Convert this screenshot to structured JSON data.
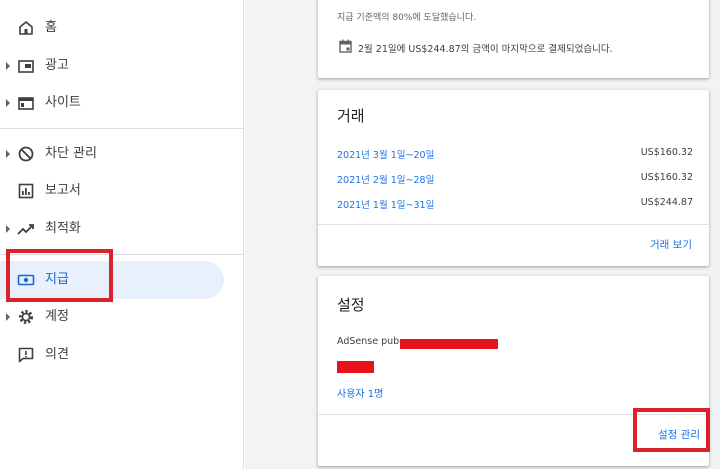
{
  "sidebar": {
    "items": [
      {
        "label": "홈",
        "icon": "home-icon"
      },
      {
        "label": "광고",
        "icon": "ads-icon"
      },
      {
        "label": "사이트",
        "icon": "sites-icon"
      },
      {
        "label": "차단 관리",
        "icon": "block-icon"
      },
      {
        "label": "보고서",
        "icon": "reports-icon"
      },
      {
        "label": "최적화",
        "icon": "trending-up-icon"
      },
      {
        "label": "지급",
        "icon": "payments-icon"
      },
      {
        "label": "계정",
        "icon": "gear-icon"
      },
      {
        "label": "의견",
        "icon": "feedback-icon"
      }
    ],
    "selected": "지급"
  },
  "payment_card": {
    "threshold_text": "지급 기준액의 80%에 도달했습니다.",
    "threshold_percent": 80,
    "last_payment_text": "2월 21일에 US$244.87의 금액이 마지막으로 결제되었습니다."
  },
  "transactions_card": {
    "title": "거래",
    "rows": [
      {
        "date": "2021년 3월 1일~20일",
        "amount": "US$160.32"
      },
      {
        "date": "2021년 2월 1일~28일",
        "amount": "US$160.32"
      },
      {
        "date": "2021년 1월 1일~31일",
        "amount": "US$244.87"
      }
    ],
    "view_link": "거래 보기"
  },
  "settings_card": {
    "title": "설정",
    "publisher_label": "AdSense pub-",
    "users_link": "사용자 1명",
    "manage_link": "설정 관리"
  },
  "colors": {
    "accent": "#1a73e8",
    "selected_bg": "#e8f0fe",
    "annotation_red": "#d9222a"
  }
}
